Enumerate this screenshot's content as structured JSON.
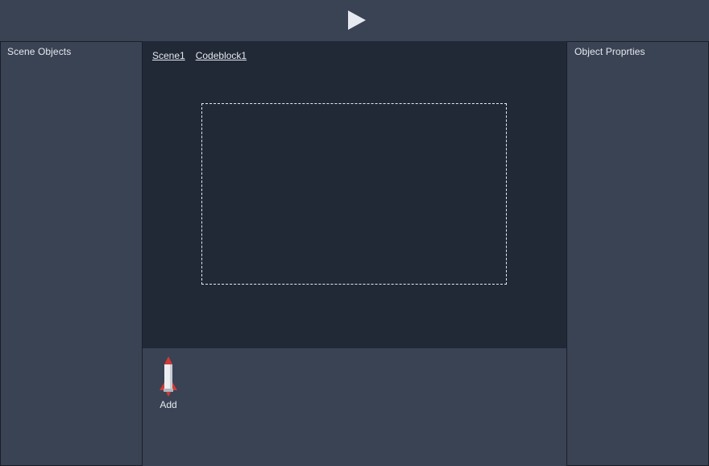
{
  "toolbar": {
    "play_icon": "play-icon"
  },
  "left_panel": {
    "title": "Scene Objects"
  },
  "right_panel": {
    "title": "Object Proprties"
  },
  "editor": {
    "tabs": [
      {
        "label": "Scene1"
      },
      {
        "label": "Codeblock1"
      }
    ]
  },
  "toolbox": {
    "items": [
      {
        "label": "Add",
        "icon": "rocket-icon"
      }
    ]
  },
  "colors": {
    "background": "#3a4354",
    "canvas": "#212937",
    "text": "#e6e9ef",
    "rocket_red": "#d23a35"
  }
}
